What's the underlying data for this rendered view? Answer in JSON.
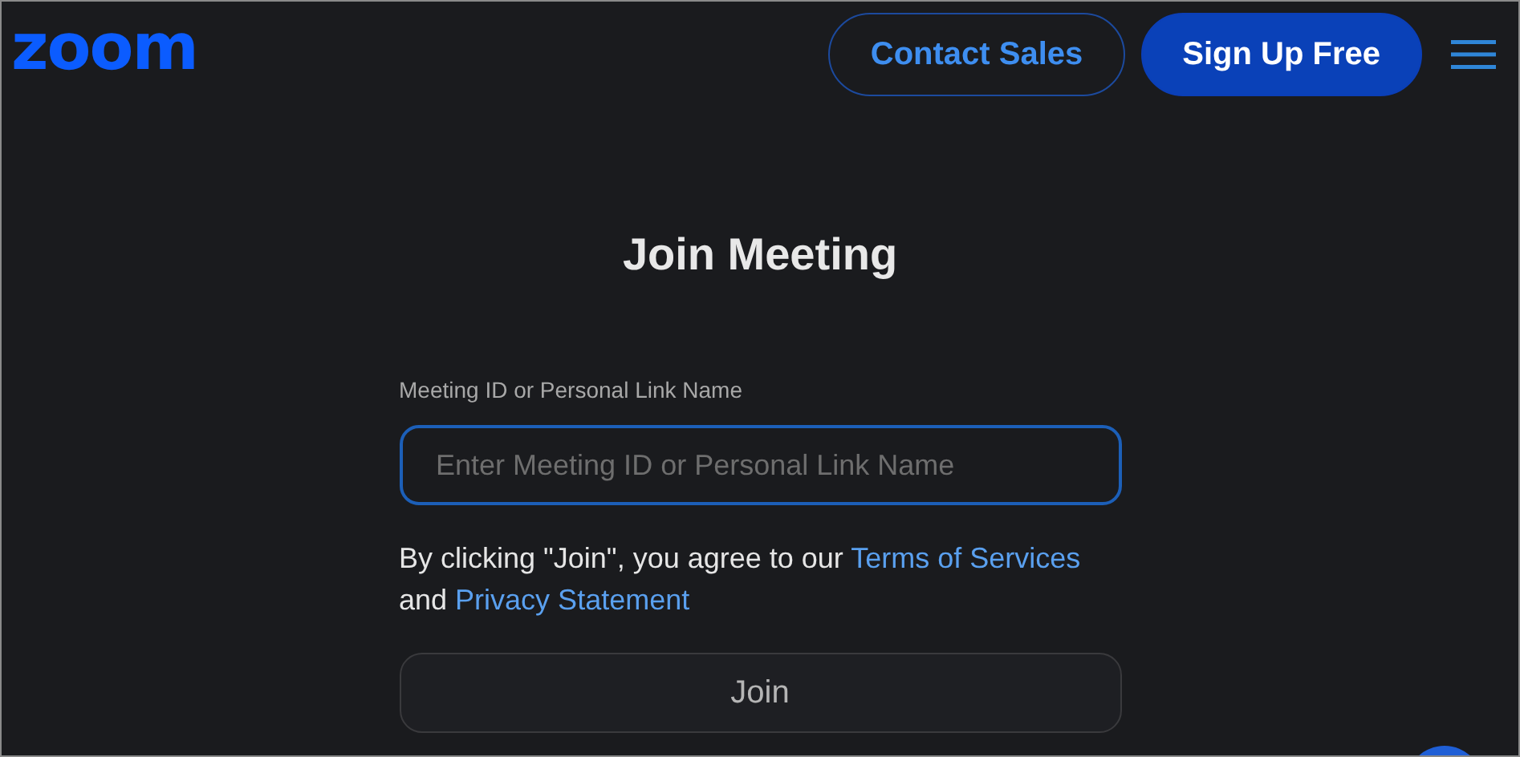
{
  "header": {
    "logo": "zoom",
    "buttons": [
      {
        "label": "Contact Sales",
        "kind": "outline"
      },
      {
        "label": "Sign Up Free",
        "kind": "filled"
      }
    ]
  },
  "title": "Join Meeting",
  "field": {
    "label": "Meeting ID or Personal Link Name",
    "placeholder": "Enter Meeting ID or Personal Link Name",
    "focused": true
  },
  "consent": {
    "text": "By clicking \"Join\", you agree to our ",
    "terms_link": "Terms of Services",
    "joiner": " and ",
    "privacy_link": "Privacy Statement"
  },
  "join_button": {
    "label": "Join",
    "disabled": true
  }
}
